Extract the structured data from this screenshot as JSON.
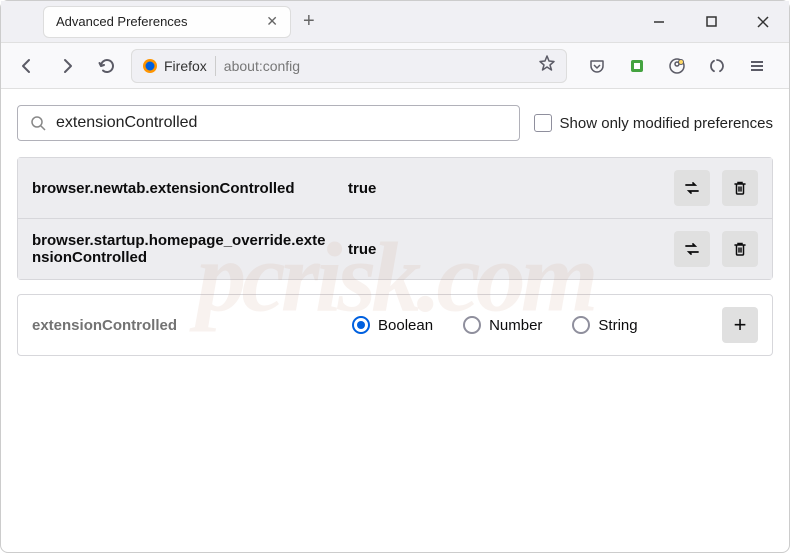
{
  "titlebar": {
    "tab_title": "Advanced Preferences"
  },
  "toolbar": {
    "firefox_label": "Firefox",
    "url": "about:config"
  },
  "search": {
    "value": "extensionControlled",
    "checkbox_label": "Show only modified preferences"
  },
  "prefs": [
    {
      "name": "browser.newtab.extensionControlled",
      "value": "true"
    },
    {
      "name": "browser.startup.homepage_override.extensionControlled",
      "value": "true"
    }
  ],
  "new_pref": {
    "name": "extensionControlled",
    "types": [
      "Boolean",
      "Number",
      "String"
    ],
    "selected": "Boolean"
  },
  "watermark": "pcrisk.com"
}
